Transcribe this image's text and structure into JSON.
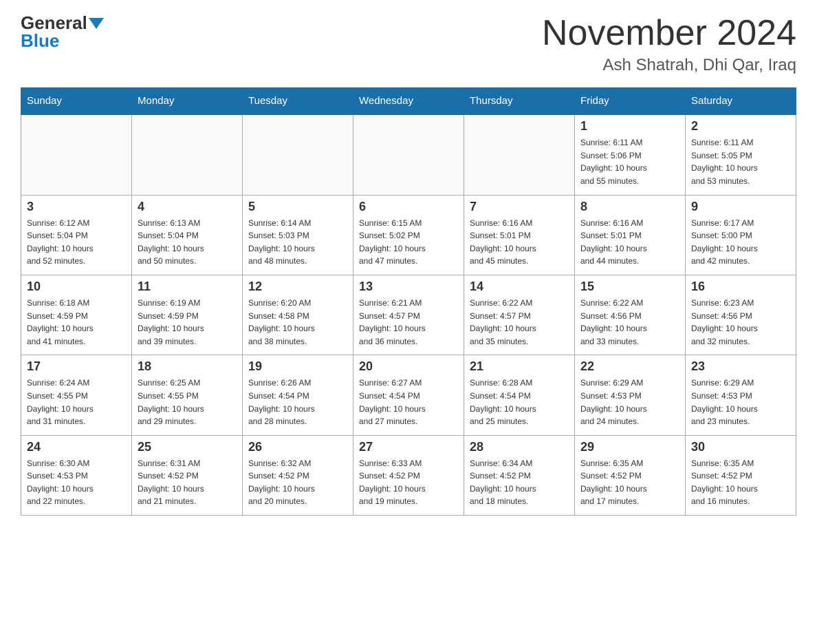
{
  "header": {
    "logo": {
      "general": "General",
      "blue": "Blue",
      "arrow_icon": "triangle-down"
    },
    "title": "November 2024",
    "location": "Ash Shatrah, Dhi Qar, Iraq"
  },
  "calendar": {
    "days_of_week": [
      "Sunday",
      "Monday",
      "Tuesday",
      "Wednesday",
      "Thursday",
      "Friday",
      "Saturday"
    ],
    "weeks": [
      [
        {
          "day": "",
          "info": ""
        },
        {
          "day": "",
          "info": ""
        },
        {
          "day": "",
          "info": ""
        },
        {
          "day": "",
          "info": ""
        },
        {
          "day": "",
          "info": ""
        },
        {
          "day": "1",
          "info": "Sunrise: 6:11 AM\nSunset: 5:06 PM\nDaylight: 10 hours\nand 55 minutes."
        },
        {
          "day": "2",
          "info": "Sunrise: 6:11 AM\nSunset: 5:05 PM\nDaylight: 10 hours\nand 53 minutes."
        }
      ],
      [
        {
          "day": "3",
          "info": "Sunrise: 6:12 AM\nSunset: 5:04 PM\nDaylight: 10 hours\nand 52 minutes."
        },
        {
          "day": "4",
          "info": "Sunrise: 6:13 AM\nSunset: 5:04 PM\nDaylight: 10 hours\nand 50 minutes."
        },
        {
          "day": "5",
          "info": "Sunrise: 6:14 AM\nSunset: 5:03 PM\nDaylight: 10 hours\nand 48 minutes."
        },
        {
          "day": "6",
          "info": "Sunrise: 6:15 AM\nSunset: 5:02 PM\nDaylight: 10 hours\nand 47 minutes."
        },
        {
          "day": "7",
          "info": "Sunrise: 6:16 AM\nSunset: 5:01 PM\nDaylight: 10 hours\nand 45 minutes."
        },
        {
          "day": "8",
          "info": "Sunrise: 6:16 AM\nSunset: 5:01 PM\nDaylight: 10 hours\nand 44 minutes."
        },
        {
          "day": "9",
          "info": "Sunrise: 6:17 AM\nSunset: 5:00 PM\nDaylight: 10 hours\nand 42 minutes."
        }
      ],
      [
        {
          "day": "10",
          "info": "Sunrise: 6:18 AM\nSunset: 4:59 PM\nDaylight: 10 hours\nand 41 minutes."
        },
        {
          "day": "11",
          "info": "Sunrise: 6:19 AM\nSunset: 4:59 PM\nDaylight: 10 hours\nand 39 minutes."
        },
        {
          "day": "12",
          "info": "Sunrise: 6:20 AM\nSunset: 4:58 PM\nDaylight: 10 hours\nand 38 minutes."
        },
        {
          "day": "13",
          "info": "Sunrise: 6:21 AM\nSunset: 4:57 PM\nDaylight: 10 hours\nand 36 minutes."
        },
        {
          "day": "14",
          "info": "Sunrise: 6:22 AM\nSunset: 4:57 PM\nDaylight: 10 hours\nand 35 minutes."
        },
        {
          "day": "15",
          "info": "Sunrise: 6:22 AM\nSunset: 4:56 PM\nDaylight: 10 hours\nand 33 minutes."
        },
        {
          "day": "16",
          "info": "Sunrise: 6:23 AM\nSunset: 4:56 PM\nDaylight: 10 hours\nand 32 minutes."
        }
      ],
      [
        {
          "day": "17",
          "info": "Sunrise: 6:24 AM\nSunset: 4:55 PM\nDaylight: 10 hours\nand 31 minutes."
        },
        {
          "day": "18",
          "info": "Sunrise: 6:25 AM\nSunset: 4:55 PM\nDaylight: 10 hours\nand 29 minutes."
        },
        {
          "day": "19",
          "info": "Sunrise: 6:26 AM\nSunset: 4:54 PM\nDaylight: 10 hours\nand 28 minutes."
        },
        {
          "day": "20",
          "info": "Sunrise: 6:27 AM\nSunset: 4:54 PM\nDaylight: 10 hours\nand 27 minutes."
        },
        {
          "day": "21",
          "info": "Sunrise: 6:28 AM\nSunset: 4:54 PM\nDaylight: 10 hours\nand 25 minutes."
        },
        {
          "day": "22",
          "info": "Sunrise: 6:29 AM\nSunset: 4:53 PM\nDaylight: 10 hours\nand 24 minutes."
        },
        {
          "day": "23",
          "info": "Sunrise: 6:29 AM\nSunset: 4:53 PM\nDaylight: 10 hours\nand 23 minutes."
        }
      ],
      [
        {
          "day": "24",
          "info": "Sunrise: 6:30 AM\nSunset: 4:53 PM\nDaylight: 10 hours\nand 22 minutes."
        },
        {
          "day": "25",
          "info": "Sunrise: 6:31 AM\nSunset: 4:52 PM\nDaylight: 10 hours\nand 21 minutes."
        },
        {
          "day": "26",
          "info": "Sunrise: 6:32 AM\nSunset: 4:52 PM\nDaylight: 10 hours\nand 20 minutes."
        },
        {
          "day": "27",
          "info": "Sunrise: 6:33 AM\nSunset: 4:52 PM\nDaylight: 10 hours\nand 19 minutes."
        },
        {
          "day": "28",
          "info": "Sunrise: 6:34 AM\nSunset: 4:52 PM\nDaylight: 10 hours\nand 18 minutes."
        },
        {
          "day": "29",
          "info": "Sunrise: 6:35 AM\nSunset: 4:52 PM\nDaylight: 10 hours\nand 17 minutes."
        },
        {
          "day": "30",
          "info": "Sunrise: 6:35 AM\nSunset: 4:52 PM\nDaylight: 10 hours\nand 16 minutes."
        }
      ]
    ]
  }
}
